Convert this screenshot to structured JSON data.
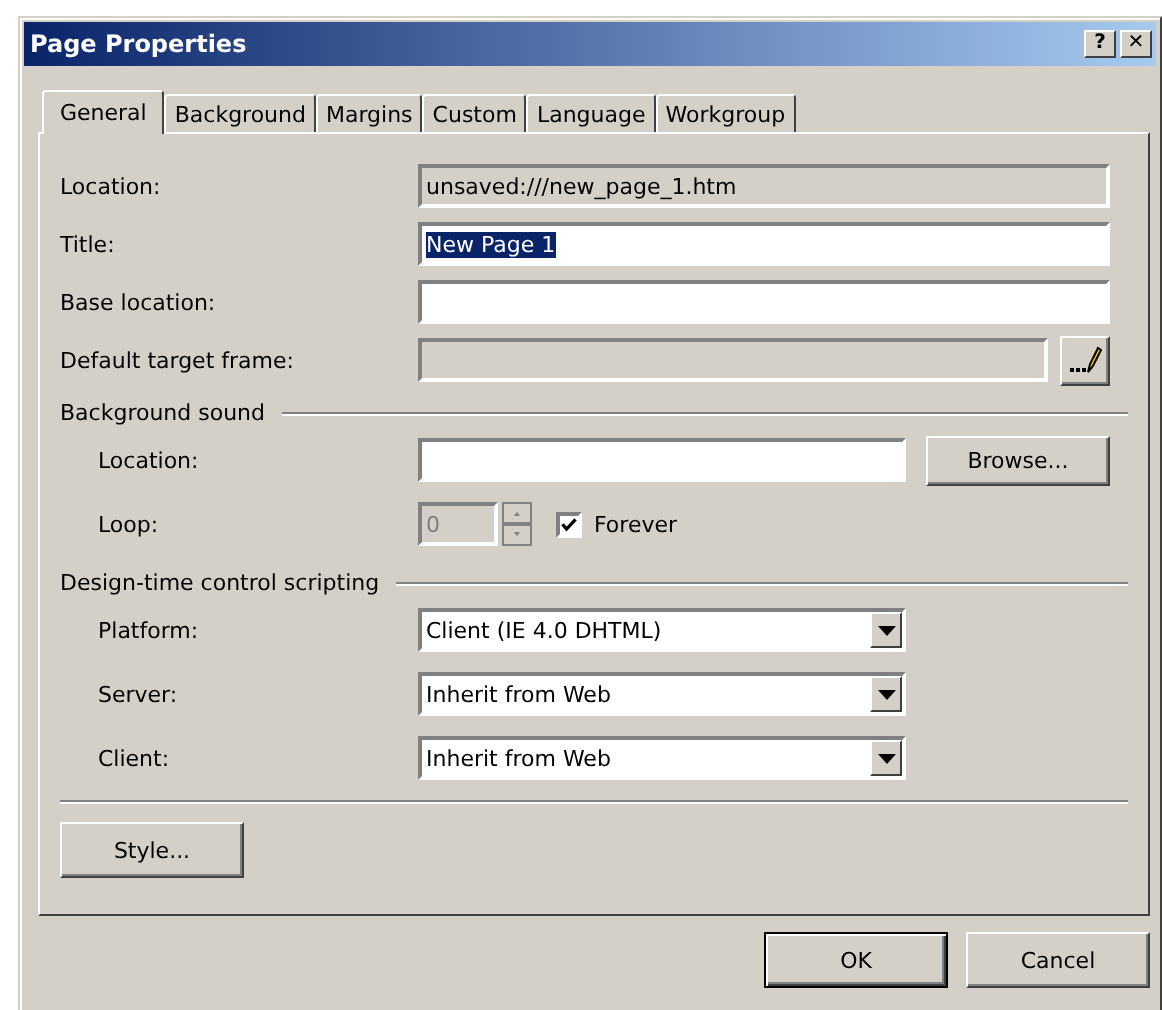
{
  "window": {
    "title": "Page Properties",
    "controls": [
      "?",
      "✕"
    ]
  },
  "tabs": [
    {
      "label": "General",
      "selected": true
    },
    {
      "label": "Background",
      "selected": false
    },
    {
      "label": "Margins",
      "selected": false
    },
    {
      "label": "Custom",
      "selected": false
    },
    {
      "label": "Language",
      "selected": false
    },
    {
      "label": "Workgroup",
      "selected": false
    }
  ],
  "fields": [
    {
      "kind": "text",
      "label": "Location:",
      "value": "unsaved:///new_page_1.htm",
      "read_only": true
    },
    {
      "kind": "text",
      "label": "Title:",
      "value": "New Page 1",
      "text_selected": true
    },
    {
      "kind": "text",
      "label": "Base location:"
    },
    {
      "kind": "picker",
      "label": "Default target frame:",
      "disabled": true
    }
  ],
  "sections": [
    {
      "heading": "Background sound",
      "rows": [
        {
          "kind": "browse",
          "label": "Location:",
          "button": {
            "label": "Browse..."
          }
        },
        {
          "kind": "spinner",
          "label": "Loop:",
          "value": "0",
          "disabled": true,
          "checkbox": {
            "label": "Forever",
            "checked": true
          }
        }
      ]
    },
    {
      "heading": "Design-time control scripting",
      "rows": [
        {
          "kind": "dropdown",
          "label": "Platform:",
          "value": "Client (IE 4.0 DHTML)"
        },
        {
          "kind": "dropdown",
          "label": "Server:",
          "value": "Inherit from Web"
        },
        {
          "kind": "dropdown",
          "label": "Client:",
          "value": "Inherit from Web"
        }
      ]
    }
  ],
  "style_button": {
    "label": "Style..."
  },
  "buttons": [
    {
      "label": "OK",
      "default": true
    },
    {
      "label": "Cancel",
      "default": false
    }
  ]
}
